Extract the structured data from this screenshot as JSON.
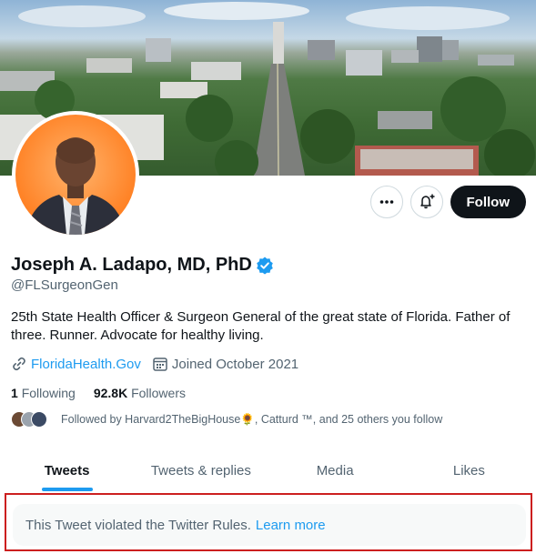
{
  "profile": {
    "display_name": "Joseph A. Ladapo, MD, PhD",
    "handle": "@FLSurgeonGen",
    "bio": "25th State Health Officer & Surgeon General of the great state of Florida. Father of three. Runner. Advocate for healthy living.",
    "website": "FloridaHealth.Gov",
    "joined": "Joined October 2021",
    "following_count": "1",
    "following_label": "Following",
    "followers_count": "92.8K",
    "followers_label": "Followers",
    "followed_by": "Followed by Harvard2TheBigHouse🌻, Catturd ™, and 25 others you follow"
  },
  "actions": {
    "follow_label": "Follow",
    "more_icon": "more-icon",
    "notify_icon": "bell-plus-icon"
  },
  "tabs": [
    {
      "label": "Tweets",
      "active": true
    },
    {
      "label": "Tweets & replies",
      "active": false
    },
    {
      "label": "Media",
      "active": false
    },
    {
      "label": "Likes",
      "active": false
    }
  ],
  "notice": {
    "text": "This Tweet violated the Twitter Rules.",
    "link": "Learn more"
  },
  "colors": {
    "accent": "#1d9bf0",
    "text_primary": "#0f1419",
    "text_secondary": "#536471",
    "highlight_border": "#cc1f1f"
  }
}
